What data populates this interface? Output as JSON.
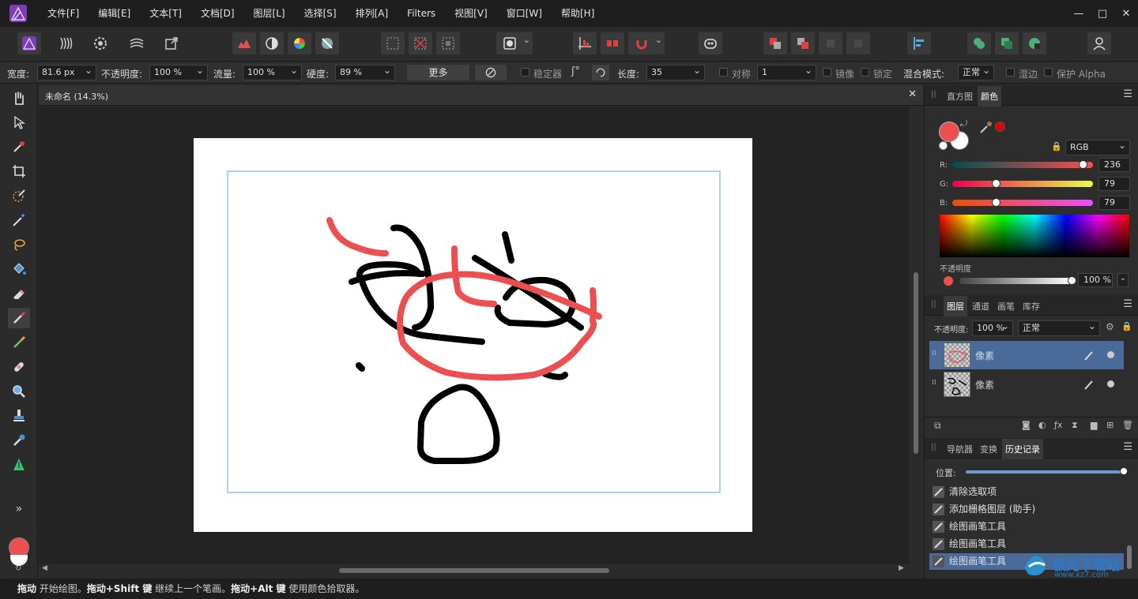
{
  "menu": [
    "文件[F]",
    "编辑[E]",
    "文本[T]",
    "文档[D]",
    "图层[L]",
    "选择[S]",
    "排列[A]",
    "Filters",
    "视图[V]",
    "窗口[W]",
    "帮助[H]"
  ],
  "window_controls": [
    "—",
    "□",
    "✕"
  ],
  "context_bar": {
    "width_label": "宽度:",
    "width_value": "81.6 px",
    "opacity_label": "不透明度:",
    "opacity_value": "100 %",
    "flow_label": "流量:",
    "flow_value": "100 %",
    "hardness_label": "硬度:",
    "hardness_value": "89 %",
    "more_button": "更多",
    "stabilizer_label": "稳定器",
    "length_label": "长度:",
    "length_value": "35",
    "symmetry_label": "对称",
    "symmetry_value": "1",
    "mirror_label": "镜像",
    "lock_label": "锁定",
    "blend_label": "混合模式:",
    "blend_value": "正常",
    "wet_edges_label": "湿边",
    "protect_alpha_label": "保护 Alpha"
  },
  "document": {
    "title": "未命名 (14.3%)",
    "close": "✕"
  },
  "colors": {
    "accent_red": "#ec4f4f",
    "selection": "#4a6a9a",
    "canvas_bg": "#232323"
  },
  "color_panel": {
    "tabs": [
      "直方图",
      "颜色"
    ],
    "active_tab": "颜色",
    "model": "RGB",
    "r_label": "R:",
    "r_value": "236",
    "g_label": "G:",
    "g_value": "79",
    "b_label": "B:",
    "b_value": "79",
    "opacity_label": "不透明度",
    "opacity_value": "100 %",
    "r_fraction": 0.925,
    "g_fraction": 0.31,
    "b_fraction": 0.31,
    "opacity_fraction": 1.0
  },
  "layers_panel": {
    "tabs": [
      "图层",
      "通道",
      "画笔",
      "库存"
    ],
    "active_tab": "图层",
    "opacity_label": "不透明度:",
    "opacity_value": "100 %",
    "blend_value": "正常",
    "layers": [
      {
        "name": "像素",
        "selected": true
      },
      {
        "name": "像素",
        "selected": false
      }
    ]
  },
  "history_panel": {
    "tabs": [
      "导航器",
      "变换",
      "历史记录"
    ],
    "active_tab": "历史记录",
    "position_label": "位置:",
    "position_fraction": 1.0,
    "items": [
      "清除选取项",
      "添加栅格图层 (助手)",
      "绘图画笔工具",
      "绘图画笔工具",
      "绘图画笔工具"
    ],
    "selected_index": 4
  },
  "status": {
    "drag1": "拖动",
    "text1": " 开始绘图。",
    "drag2": "拖动+Shift 键",
    "text2": " 继续上一个笔画。",
    "drag3": "拖动+Alt 键",
    "text3": " 使用颜色拾取器。"
  },
  "watermark": {
    "line1": "极光下载站",
    "line2": "www.xz7.com"
  },
  "tools_more": "»"
}
